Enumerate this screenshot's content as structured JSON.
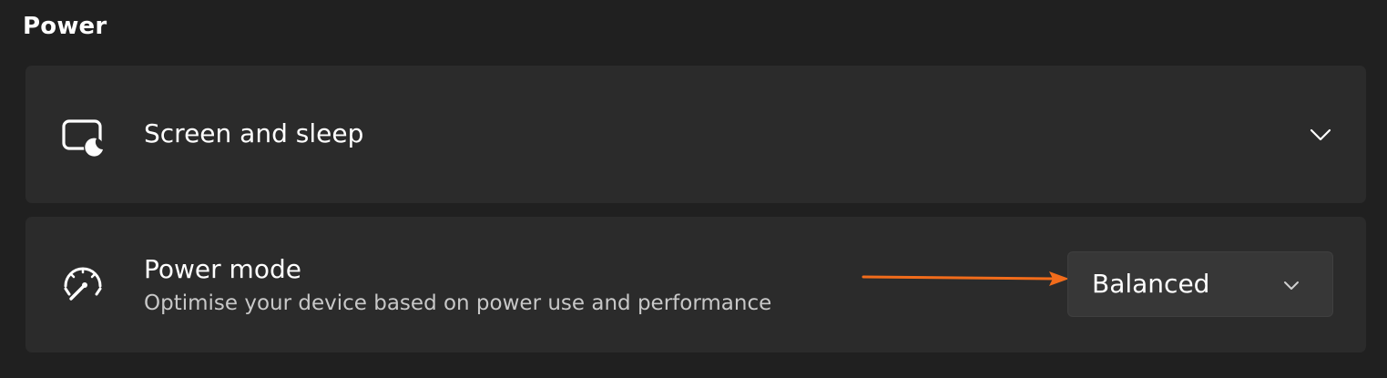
{
  "section": {
    "title": "Power"
  },
  "screen_sleep": {
    "label": "Screen and sleep",
    "icon": "screen-sleep-icon",
    "expand_icon": "chevron-down-icon"
  },
  "power_mode": {
    "label": "Power mode",
    "description": "Optimise your device based on power use and performance",
    "icon": "power-gauge-icon",
    "selected_value": "Balanced",
    "dropdown_icon": "chevron-down-icon"
  },
  "annotation": {
    "type": "arrow",
    "color": "#f26c1b"
  },
  "colors": {
    "background": "#202020",
    "card": "#2b2b2b",
    "dropdown": "#373737",
    "text_primary": "#ffffff",
    "text_secondary": "#c8c8c8"
  }
}
